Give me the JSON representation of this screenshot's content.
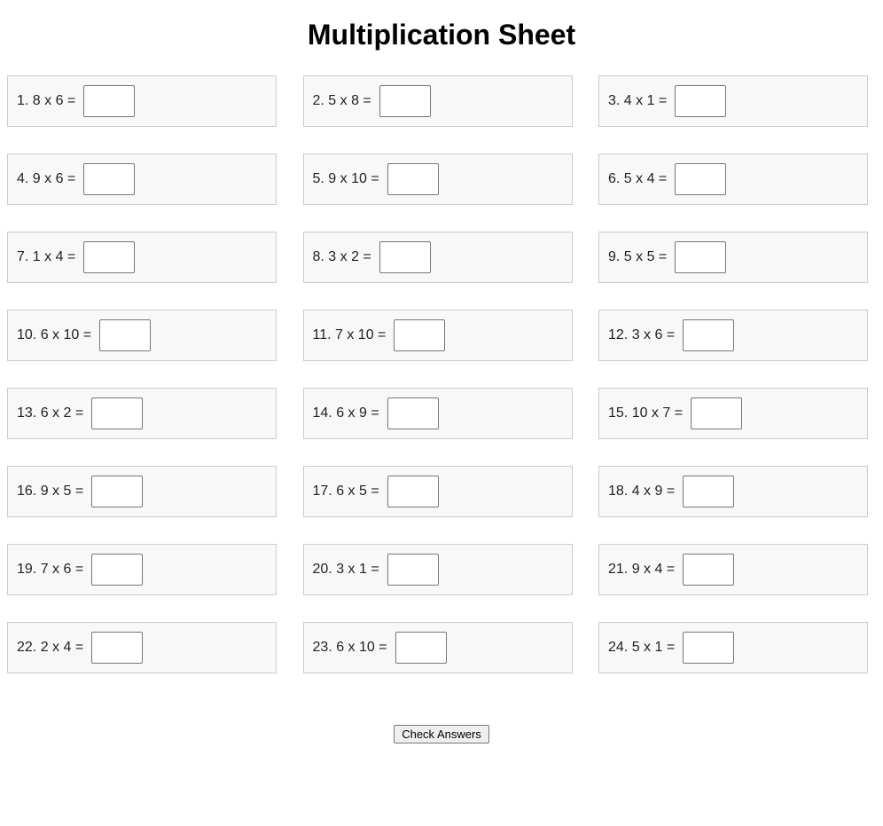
{
  "title": "Multiplication Sheet",
  "problems": [
    {
      "label": "1. 8 x 6 =",
      "answer": ""
    },
    {
      "label": "2. 5 x 8 =",
      "answer": ""
    },
    {
      "label": "3. 4 x 1 =",
      "answer": ""
    },
    {
      "label": "4. 9 x 6 =",
      "answer": ""
    },
    {
      "label": "5. 9 x 10 =",
      "answer": ""
    },
    {
      "label": "6. 5 x 4 =",
      "answer": ""
    },
    {
      "label": "7. 1 x 4 =",
      "answer": ""
    },
    {
      "label": "8. 3 x 2 =",
      "answer": ""
    },
    {
      "label": "9. 5 x 5 =",
      "answer": ""
    },
    {
      "label": "10. 6 x 10 =",
      "answer": ""
    },
    {
      "label": "11. 7 x 10 =",
      "answer": ""
    },
    {
      "label": "12. 3 x 6 =",
      "answer": ""
    },
    {
      "label": "13. 6 x 2 =",
      "answer": ""
    },
    {
      "label": "14. 6 x 9 =",
      "answer": ""
    },
    {
      "label": "15. 10 x 7 =",
      "answer": ""
    },
    {
      "label": "16. 9 x 5 =",
      "answer": ""
    },
    {
      "label": "17. 6 x 5 =",
      "answer": ""
    },
    {
      "label": "18. 4 x 9 =",
      "answer": ""
    },
    {
      "label": "19. 7 x 6 =",
      "answer": ""
    },
    {
      "label": "20. 3 x 1 =",
      "answer": ""
    },
    {
      "label": "21. 9 x 4 =",
      "answer": ""
    },
    {
      "label": "22. 2 x 4 =",
      "answer": ""
    },
    {
      "label": "23. 6 x 10 =",
      "answer": ""
    },
    {
      "label": "24. 5 x 1 =",
      "answer": ""
    }
  ],
  "check_button_label": "Check Answers",
  "colors": {
    "card_background": "#f8f8f8",
    "card_border": "#cccccc",
    "button_background": "#efefef"
  }
}
